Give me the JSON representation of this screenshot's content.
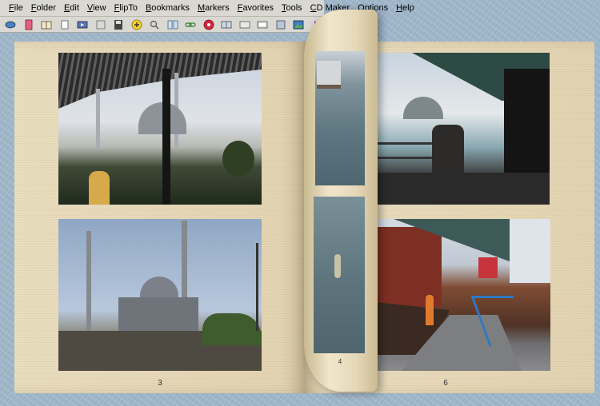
{
  "menu": {
    "items": [
      "File",
      "Folder",
      "Edit",
      "View",
      "FlipTo",
      "Bookmarks",
      "Markers",
      "Favorites",
      "Tools",
      "CD Maker",
      "Options",
      "Help"
    ]
  },
  "toolbar": {
    "buttons": [
      "new-album-icon",
      "delete-icon",
      "open-book-icon",
      "page-icon",
      "forward-icon",
      "image-icon",
      "save-icon",
      "add-icon",
      "zoom-icon",
      "columns-icon",
      "link-icon",
      "stop-icon",
      "spread-icon",
      "thumbnail-icon",
      "screen-icon",
      "frame-icon",
      "photo-icon",
      "play-icon",
      "sun-icon"
    ]
  },
  "book": {
    "left_page_number": "3",
    "right_page_number": "6",
    "curl_page_number": "4"
  },
  "colors": {
    "desk": "#9fb6c9",
    "page": "#e7dbbd",
    "chrome": "#d9d8d2"
  }
}
